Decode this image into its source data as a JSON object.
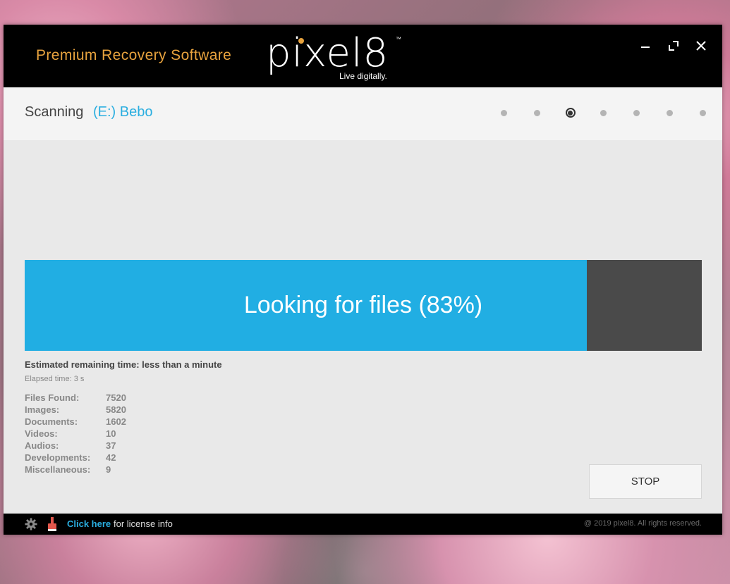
{
  "app": {
    "tagline": "Premium Recovery Software",
    "logo": {
      "word": "pixel8",
      "tm": "™",
      "subtitle": "Live digitally."
    }
  },
  "window_controls": {
    "minimize": "—",
    "maximize": "maximize",
    "close": "✕"
  },
  "header": {
    "scanning_label": "Scanning",
    "drive_label": "(E:) Bebo",
    "steps": {
      "total": 7,
      "current": 3
    }
  },
  "progress": {
    "text": "Looking for files (83%)",
    "percent": 83
  },
  "info": {
    "eta": "Estimated remaining time: less than a minute",
    "elapsed": "Elapsed time: 3 s"
  },
  "stats": [
    {
      "label": "Files Found:",
      "value": "7520"
    },
    {
      "label": "Images:",
      "value": "5820"
    },
    {
      "label": "Documents:",
      "value": "1602"
    },
    {
      "label": "Videos:",
      "value": "10"
    },
    {
      "label": "Audios:",
      "value": "37"
    },
    {
      "label": "Developments:",
      "value": "42"
    },
    {
      "label": "Miscellaneous:",
      "value": "9"
    }
  ],
  "stop_button": "STOP",
  "footer": {
    "link_text": "Click here",
    "rest_text": "for license info",
    "copyright": "@ 2019 pixel8. All rights reserved.",
    "icons": [
      "gear-icon",
      "license-icon"
    ]
  },
  "colors": {
    "accent": "#21aee3",
    "brand_orange": "#e8a33e",
    "progress_track": "#4a4a4a"
  }
}
